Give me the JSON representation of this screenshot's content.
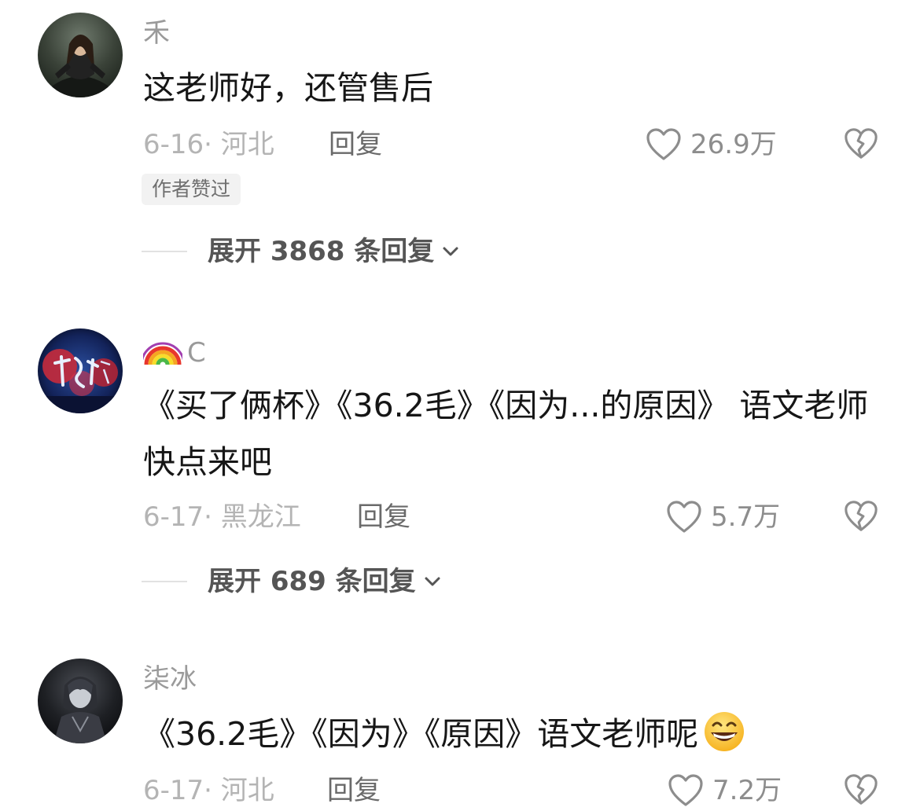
{
  "comments": [
    {
      "username": "禾",
      "text": "这老师好，还管售后",
      "date": "6-16",
      "location": "河北",
      "reply_label": "回复",
      "likes": "26.9万",
      "badge": "作者赞过",
      "expand_label": "展开 3868 条回复"
    },
    {
      "username": "C",
      "username_prefix_icon": "rainbow-emoji",
      "text": "《买了俩杯》《36.2毛》《因为...的原因》 语文老师快点来吧",
      "date": "6-17",
      "location": "黑龙江",
      "reply_label": "回复",
      "likes": "5.7万",
      "expand_label": "展开 689 条回复"
    },
    {
      "username": "柒冰",
      "text": "《36.2毛》《因为》《原因》语文老师呢",
      "text_suffix_icon": "grinning-face-emoji",
      "date": "6-17",
      "location": "河北",
      "reply_label": "回复",
      "likes": "7.2万"
    }
  ],
  "icons": {
    "like": "heart-outline-icon",
    "dislike": "broken-heart-icon",
    "expand": "chevron-down-icon"
  },
  "colors": {
    "text": "#161616",
    "meta": "#b4b4b4",
    "username": "#9a9a9a",
    "badge_bg": "#f2f2f2"
  }
}
